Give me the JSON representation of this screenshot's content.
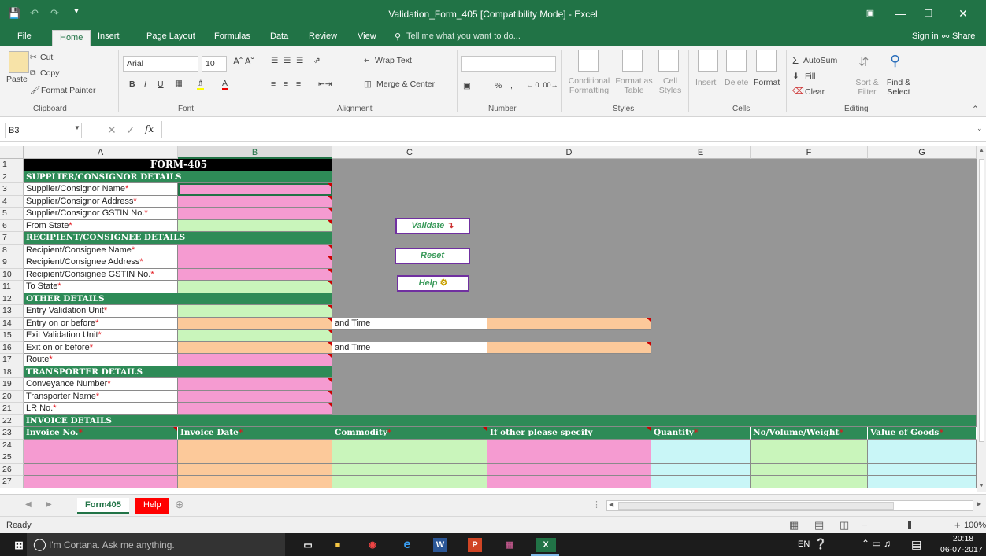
{
  "window": {
    "title": "Validation_Form_405  [Compatibility Mode] - Excel",
    "sign_in": "Sign in",
    "share": "Share"
  },
  "menu": {
    "tabs": [
      "File",
      "Home",
      "Insert",
      "Page Layout",
      "Formulas",
      "Data",
      "Review",
      "View"
    ],
    "tell_me": "Tell me what you want to do..."
  },
  "ribbon": {
    "clipboard": {
      "paste": "Paste",
      "cut": "Cut",
      "copy": "Copy",
      "format_painter": "Format Painter",
      "group": "Clipboard"
    },
    "font": {
      "name": "Arial",
      "size": "10",
      "group": "Font"
    },
    "alignment": {
      "wrap_text": "Wrap Text",
      "merge_center": "Merge & Center",
      "group": "Alignment"
    },
    "number": {
      "percent": "%",
      "comma": ",",
      "group": "Number"
    },
    "styles": {
      "conditional_formatting": "Conditional Formatting",
      "format_as_table": "Format as Table",
      "cell_styles": "Cell Styles",
      "group": "Styles"
    },
    "cells": {
      "insert": "Insert",
      "delete": "Delete",
      "format": "Format",
      "group": "Cells"
    },
    "editing": {
      "autosum": "AutoSum",
      "fill": "Fill",
      "clear": "Clear",
      "sort_filter": "Sort & Filter",
      "find_select": "Find & Select",
      "group": "Editing"
    }
  },
  "formula_bar": {
    "name_box": "B3",
    "fx": "fx",
    "formula": ""
  },
  "columns": [
    "A",
    "B",
    "C",
    "D",
    "E",
    "F",
    "G"
  ],
  "rows": {
    "r1": "FORM-405",
    "r2": "SUPPLIER/CONSIGNOR DETAILS",
    "r3": "Supplier/Consignor Name",
    "r4": "Supplier/Consignor Address",
    "r5": "Supplier/Consignor GSTIN No.",
    "r6": "From State",
    "r7": "RECIPIENT/CONSIGNEE DETAILS",
    "r8": "Recipient/Consignee Name",
    "r9": "Recipient/Consignee Address",
    "r10": "Recipient/Consignee GSTIN No.",
    "r11": "To State",
    "r12": "OTHER DETAILS",
    "r13": "Entry Validation Unit",
    "r14": "Entry on or before",
    "r15": "Exit Validation Unit",
    "r16": "Exit on or before",
    "r17": "Route",
    "r18": "TRANSPORTER DETAILS",
    "r19": "Conveyance Number",
    "r20": "Transporter Name",
    "r21": "LR No.",
    "r22": "INVOICE DETAILS",
    "and_time": "and Time",
    "asterisk": "*"
  },
  "invoice_headers": [
    "Invoice No.",
    "Invoice Date",
    "Commodity",
    "If other please specify",
    "Quantity",
    "No/Volume/Weight",
    "Value of Goods"
  ],
  "buttons": {
    "validate": "Validate",
    "reset": "Reset",
    "help": "Help"
  },
  "sheets": [
    "Form405",
    "Help"
  ],
  "status": {
    "ready": "Ready",
    "zoom": "100%"
  },
  "taskbar": {
    "cortana": "I'm Cortana. Ask me anything.",
    "lang": "EN",
    "time": "20:18",
    "date": "06-07-2017"
  }
}
